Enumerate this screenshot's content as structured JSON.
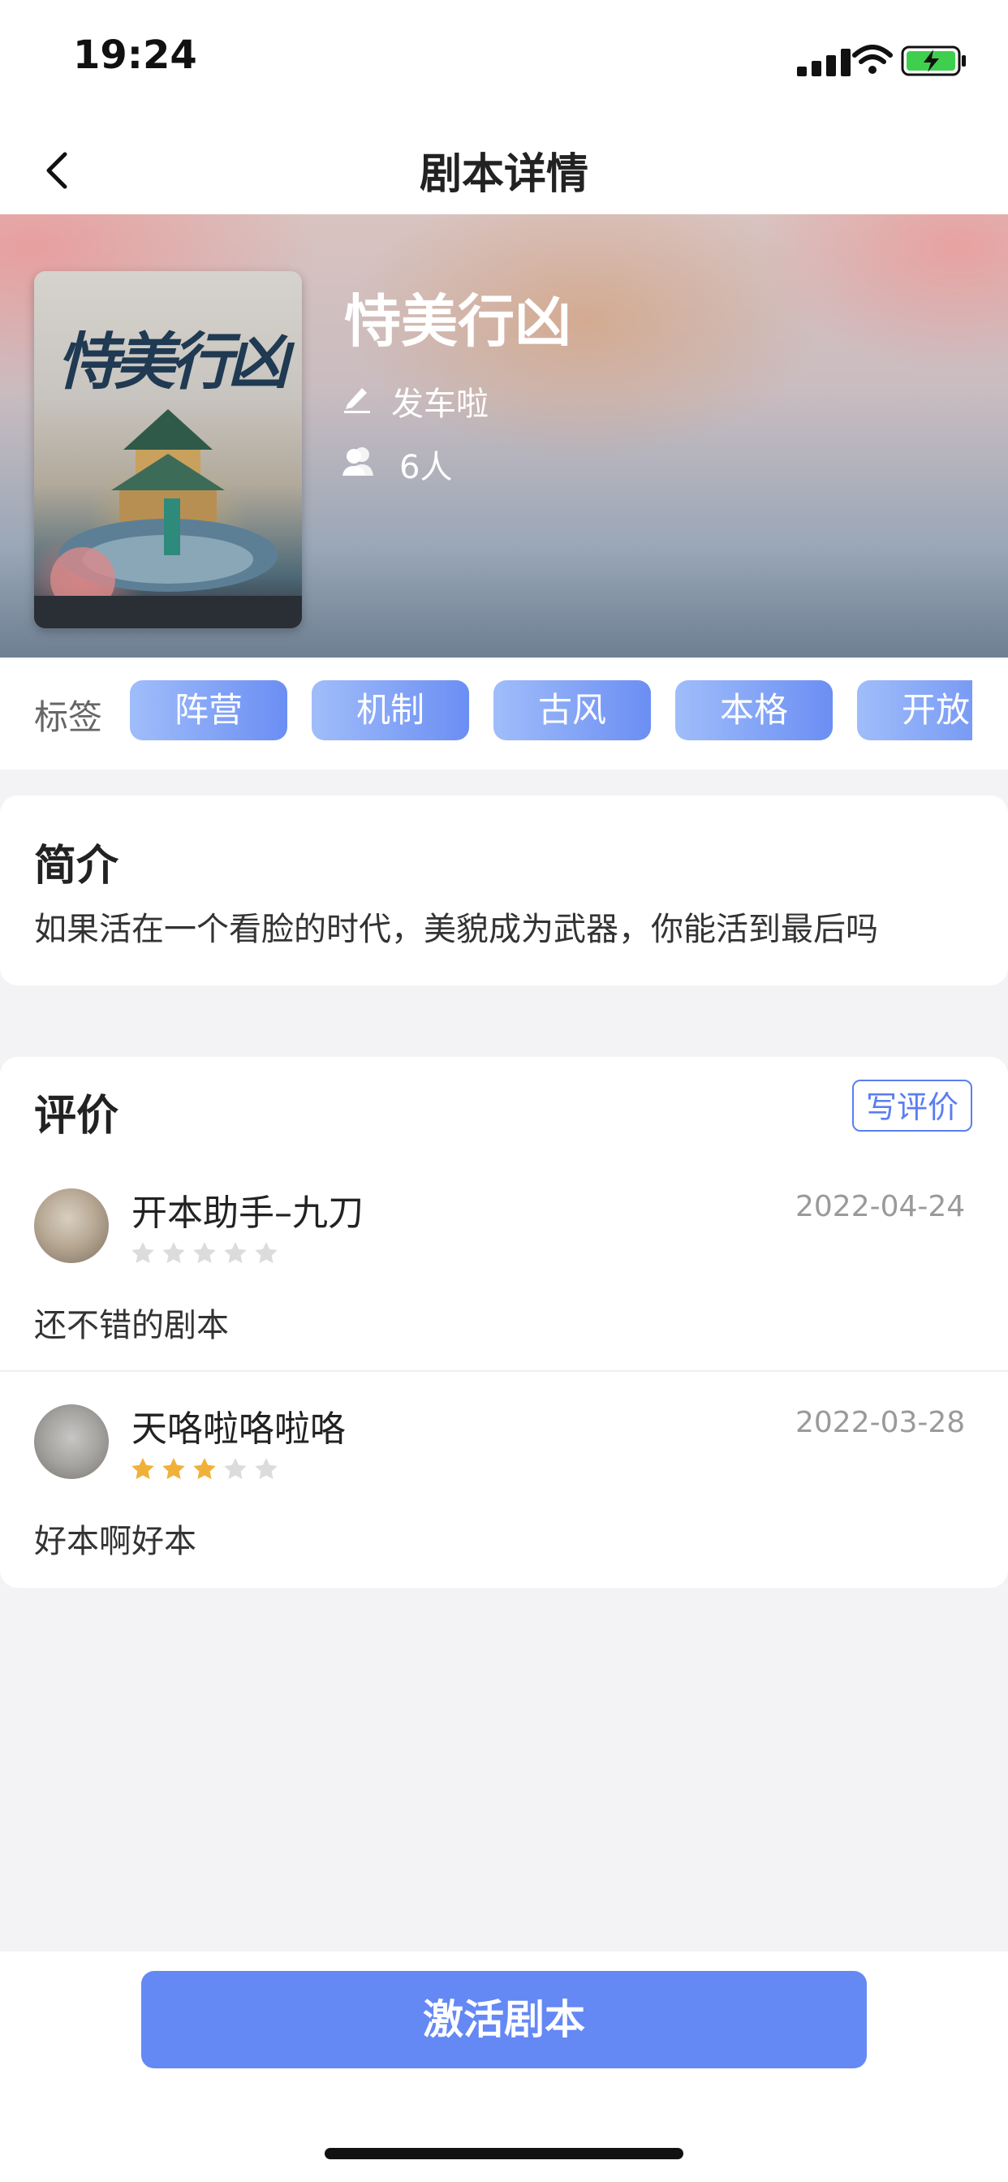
{
  "status_bar": {
    "time": "19:24"
  },
  "nav": {
    "title": "剧本详情"
  },
  "script": {
    "poster_title": "恃美行凶",
    "title": "恃美行凶",
    "author": "发车啦",
    "players": "6人"
  },
  "tags": {
    "label": "标签",
    "items": [
      "阵营",
      "机制",
      "古风",
      "本格",
      "开放"
    ]
  },
  "intro": {
    "title": "简介",
    "text": "如果活在一个看脸的时代，美貌成为武器，你能活到最后吗"
  },
  "reviews": {
    "title": "评价",
    "write_label": "写评价",
    "items": [
      {
        "name": "开本助手–九刀",
        "date": "2022-04-24",
        "rating": 0,
        "text": "还不错的剧本"
      },
      {
        "name": "天咯啦咯啦咯",
        "date": "2022-03-28",
        "rating": 3,
        "text": "好本啊好本"
      }
    ]
  },
  "bottom": {
    "activate_label": "激活剧本"
  },
  "colors": {
    "accent": "#6488f4",
    "star_on": "#f0b13a",
    "star_off": "#dcdcdc"
  }
}
